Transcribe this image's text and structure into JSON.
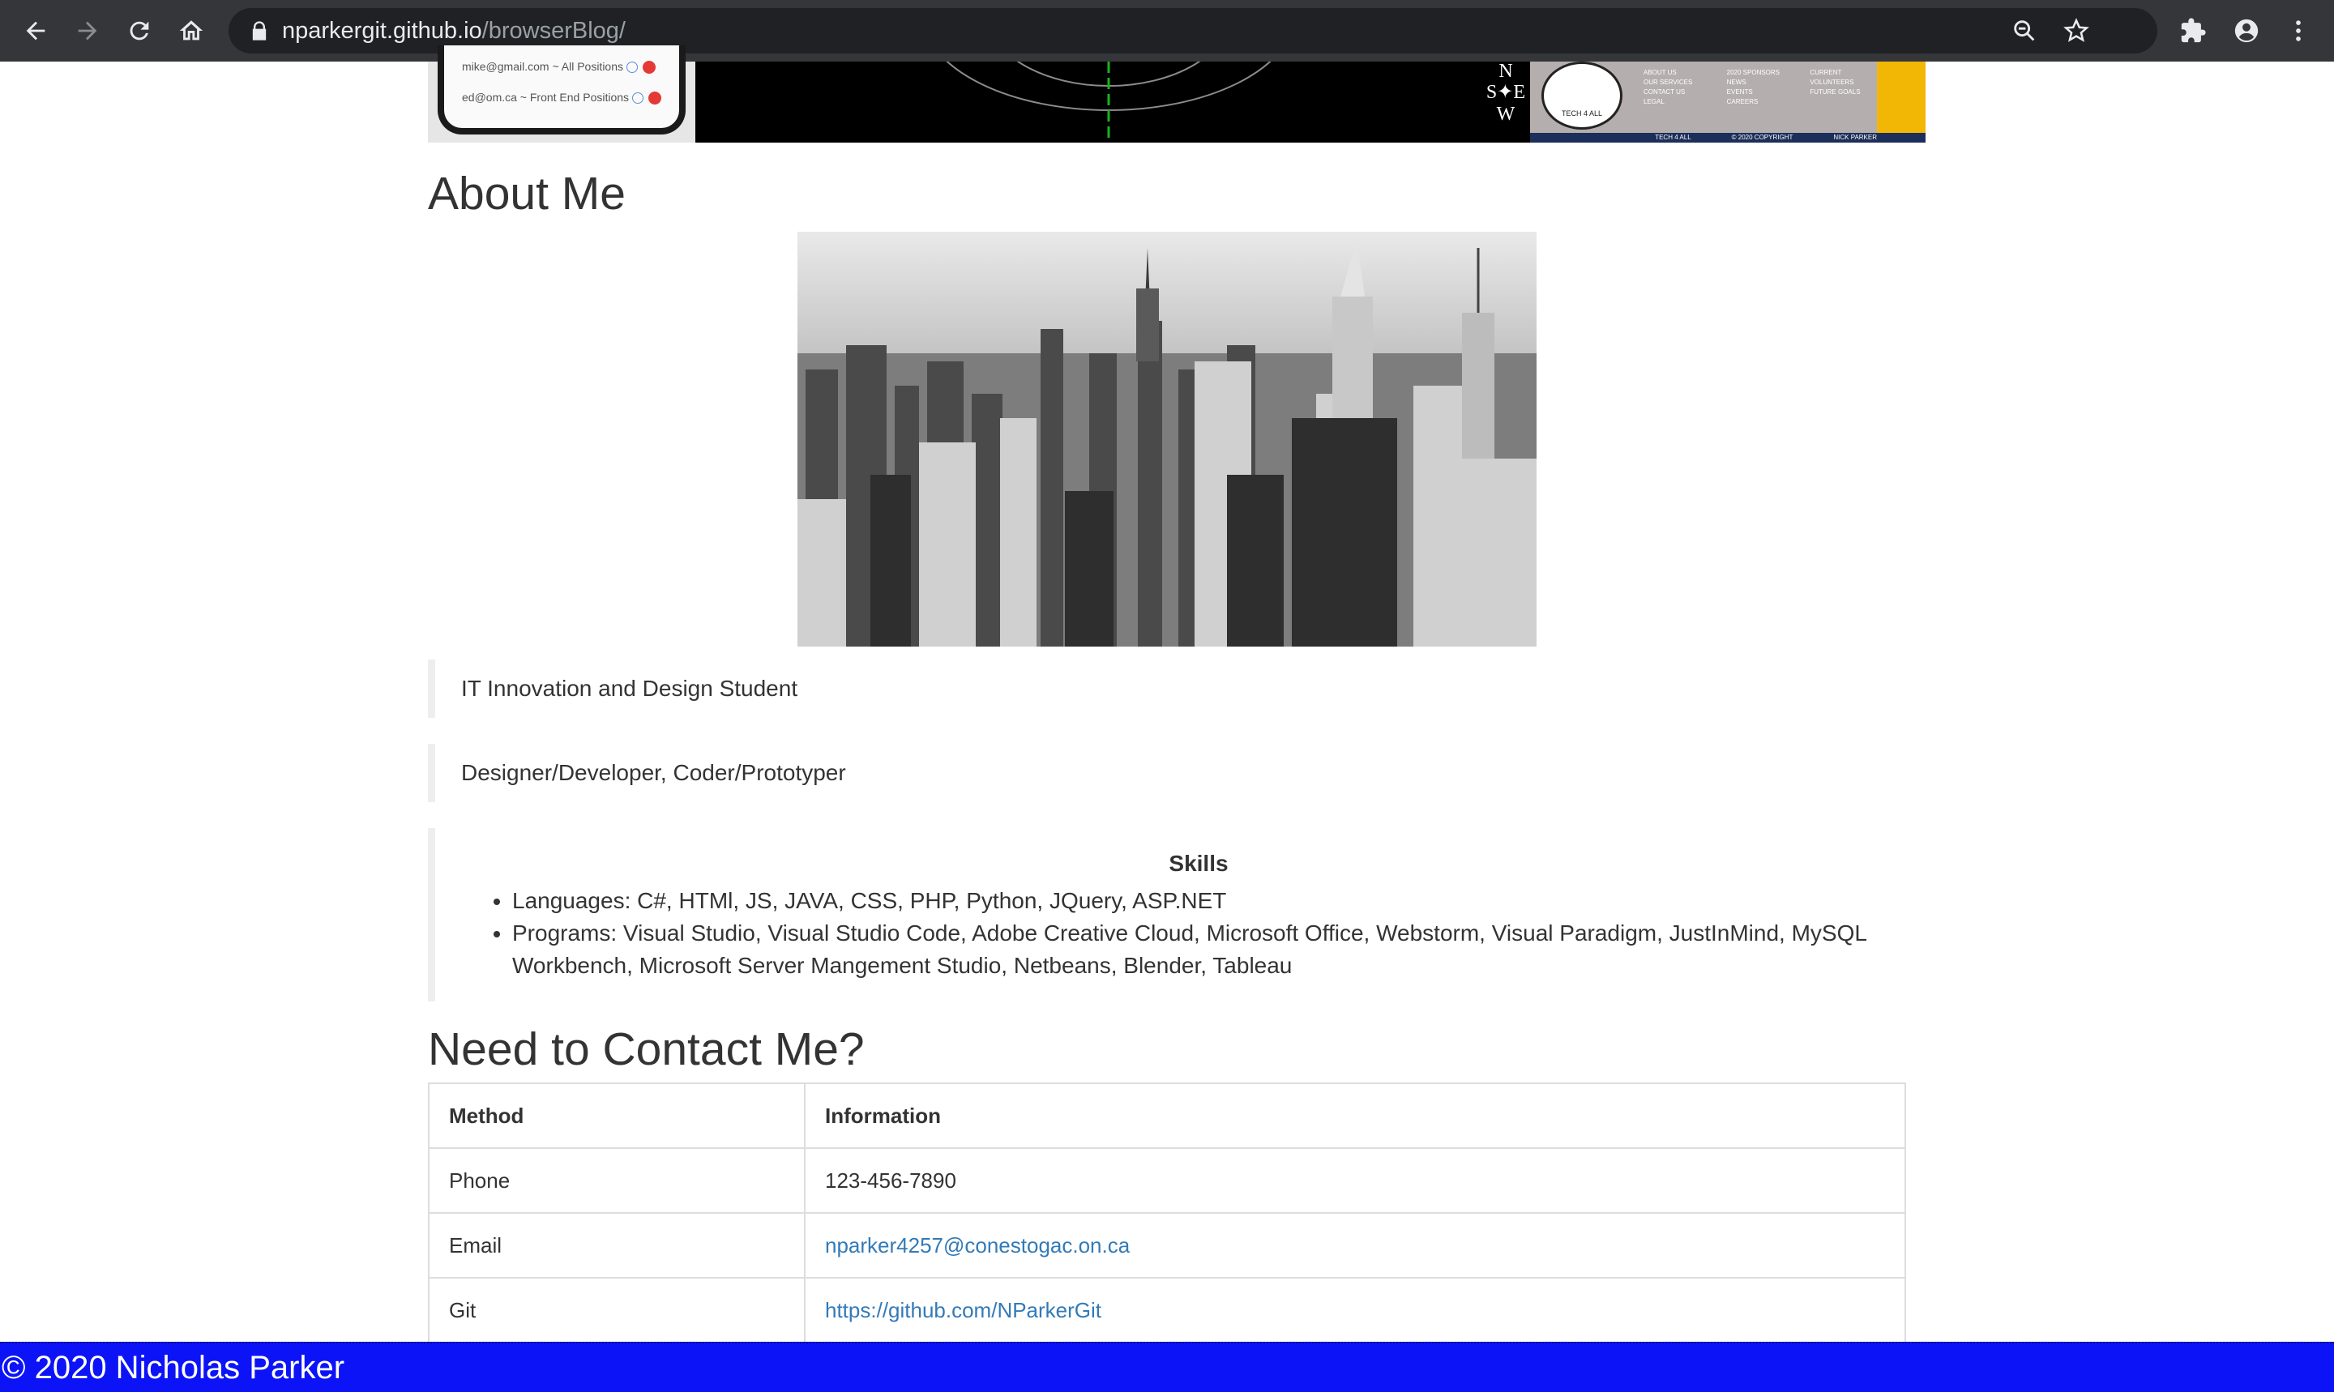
{
  "browser": {
    "url_host": "nparkergit.github.io",
    "url_path": "/browserBlog/"
  },
  "thumbnails": {
    "phone_rows": [
      "mike@gmail.com ~ All Positions",
      "ed@om.ca ~ Front End Positions"
    ],
    "compass": [
      "N",
      "S",
      "E",
      "W"
    ],
    "site_logo_text": "TECH 4 ALL",
    "site_nav": [
      "ABOUT US",
      "OUR SERVICES",
      "CONTACT US",
      "LEGAL",
      "2020 SPONSORS",
      "NEWS",
      "EVENTS",
      "CAREERS",
      "CURRENT VOLUNTEERS",
      "FUTURE GOALS"
    ],
    "site_footer": [
      "TECH 4 ALL",
      "© 2020 COPYRIGHT",
      "NICK PARKER"
    ]
  },
  "about": {
    "title": "About Me",
    "line1": "IT Innovation and Design Student",
    "line2": "Designer/Developer, Coder/Prototyper",
    "skills_title": "Skills",
    "skills": [
      "Languages: C#, HTMl, JS, JAVA, CSS, PHP, Python, JQuery, ASP.NET",
      "Programs: Visual Studio, Visual Studio Code, Adobe Creative Cloud, Microsoft Office, Webstorm, Visual Paradigm, JustInMind, MySQL Workbench, Microsoft Server Mangement Studio, Netbeans, Blender, Tableau"
    ]
  },
  "contact": {
    "title": "Need to Contact Me?",
    "headers": [
      "Method",
      "Information"
    ],
    "rows": [
      {
        "method": "Phone",
        "info": "123-456-7890"
      },
      {
        "method": "Email",
        "info": "nparker4257@conestogac.on.ca"
      },
      {
        "method": "Git",
        "info": "https://github.com/NParkerGit"
      }
    ]
  },
  "footer": {
    "text": "© 2020 Nicholas Parker"
  },
  "colors": {
    "toolbar": "#35363a",
    "omnibox": "#202124",
    "footer": "#0c14f7",
    "link": "#337ab7"
  }
}
